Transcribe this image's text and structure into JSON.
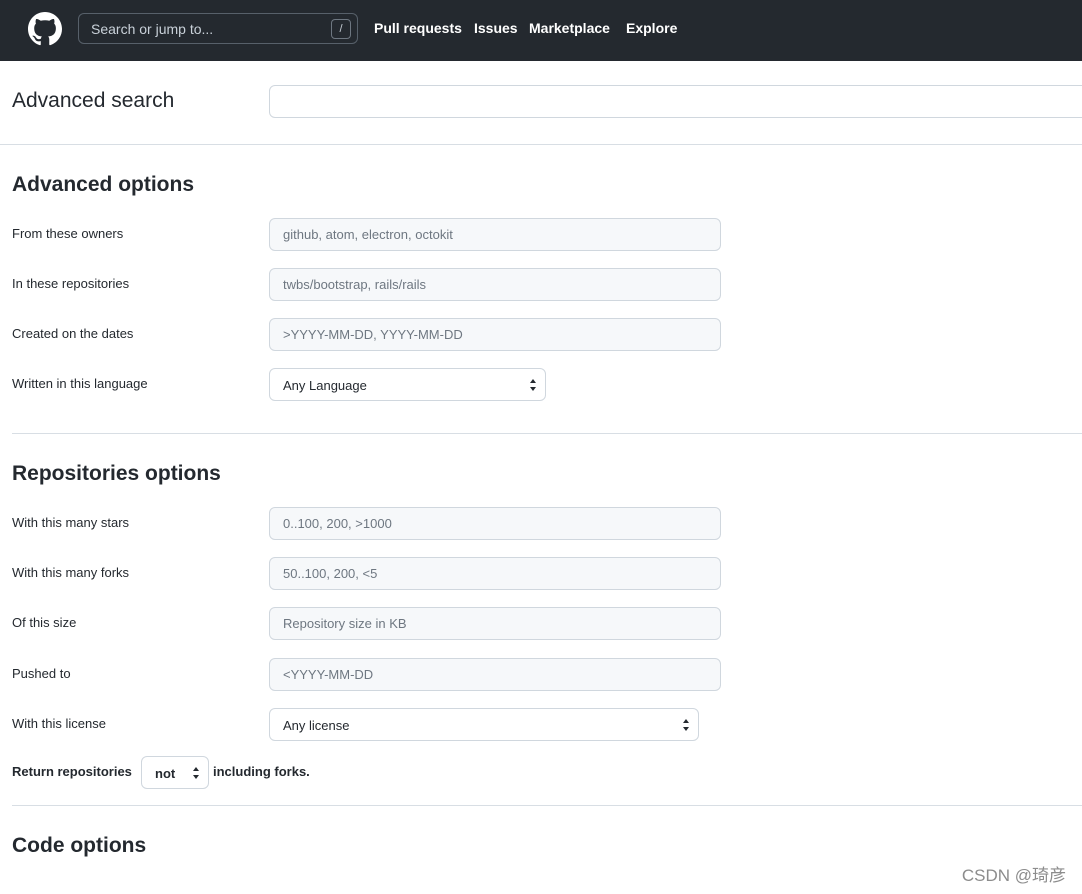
{
  "header": {
    "search_placeholder": "Search or jump to...",
    "slash_key": "/",
    "nav": {
      "pull_requests": "Pull requests",
      "issues": "Issues",
      "marketplace": "Marketplace",
      "explore": "Explore"
    },
    "logo_icon": "github-octocat-icon"
  },
  "search": {
    "title": "Advanced search",
    "value": ""
  },
  "advanced_options": {
    "title": "Advanced options",
    "owners_label": "From these owners",
    "owners_placeholder": "github, atom, electron, octokit",
    "repos_label": "In these repositories",
    "repos_placeholder": "twbs/bootstrap, rails/rails",
    "dates_label": "Created on the dates",
    "dates_placeholder": ">YYYY-MM-DD, YYYY-MM-DD",
    "language_label": "Written in this language",
    "language_value": "Any Language"
  },
  "repository_options": {
    "title": "Repositories options",
    "stars_label": "With this many stars",
    "stars_placeholder": "0..100, 200, >1000",
    "forks_label": "With this many forks",
    "forks_placeholder": "50..100, 200, <5",
    "size_label": "Of this size",
    "size_placeholder": "Repository size in KB",
    "pushed_label": "Pushed to",
    "pushed_placeholder": "<YYYY-MM-DD",
    "license_label": "With this license",
    "license_value": "Any license",
    "return_label": "Return repositories",
    "return_value": "not",
    "forks_suffix": "including forks."
  },
  "code_options": {
    "title": "Code options"
  },
  "watermark": "CSDN @琦彦",
  "colors": {
    "header_bg": "#24292f",
    "input_bg": "#f6f8fa",
    "border": "#d0d7de",
    "text": "#24292f"
  }
}
